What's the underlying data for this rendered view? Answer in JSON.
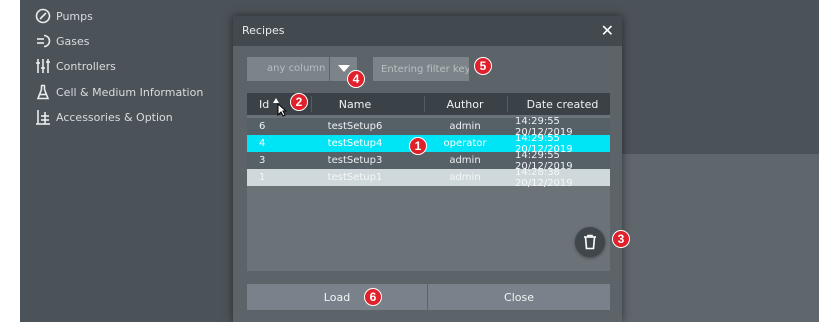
{
  "sidebar": {
    "items": [
      {
        "label": "Pumps",
        "icon": "gauge-icon"
      },
      {
        "label": "Gases",
        "icon": "gas-outlet-icon"
      },
      {
        "label": "Controllers",
        "icon": "sliders-icon"
      },
      {
        "label": "Cell & Medium Information",
        "icon": "flask-icon"
      },
      {
        "label": "Accessories & Option",
        "icon": "accessories-icon"
      }
    ]
  },
  "dialog": {
    "title": "Recipes",
    "close_glyph": "✕",
    "column_select": {
      "value": "any column"
    },
    "filter": {
      "placeholder": "Entering filter key",
      "value": ""
    },
    "table": {
      "headers": {
        "id": "Id",
        "name": "Name",
        "author": "Author",
        "date": "Date created"
      },
      "sort": {
        "column": "Id",
        "direction": "ascending"
      },
      "rows": [
        {
          "id": "6",
          "name": "testSetup6",
          "author": "admin",
          "date": "14:29:55 20/12/2019",
          "state": "normal"
        },
        {
          "id": "4",
          "name": "testSetup4",
          "author": "operator",
          "date": "14:29:55 20/12/2019",
          "state": "selected"
        },
        {
          "id": "3",
          "name": "testSetup3",
          "author": "admin",
          "date": "14:29:55 20/12/2019",
          "state": "normal"
        },
        {
          "id": "1",
          "name": "testSetup1",
          "author": "admin",
          "date": "14:28:38 20/12/2019",
          "state": "disabled"
        }
      ]
    },
    "buttons": {
      "load": "Load",
      "close": "Close",
      "delete_icon": "trash-icon"
    }
  },
  "annotations": [
    "1",
    "2",
    "3",
    "4",
    "5",
    "6"
  ],
  "colors": {
    "selected_row": "#00e5f5",
    "row_normal": "#566067",
    "row_disabled": "#cfd9dc",
    "badge": "#e0202b"
  }
}
